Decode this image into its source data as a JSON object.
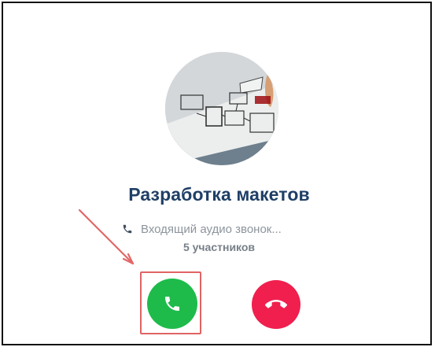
{
  "call": {
    "title": "Разработка макетов",
    "status": "Входящий аудио звонок...",
    "participants": "5 участников"
  },
  "icons": {
    "status": "phone-icon",
    "accept": "phone-icon",
    "decline": "phone-hangup-icon",
    "annotation": "arrow-icon"
  },
  "colors": {
    "title": "#1f3f66",
    "accept": "#1ebb4b",
    "decline": "#f01f4e",
    "highlight": "#e06464"
  }
}
